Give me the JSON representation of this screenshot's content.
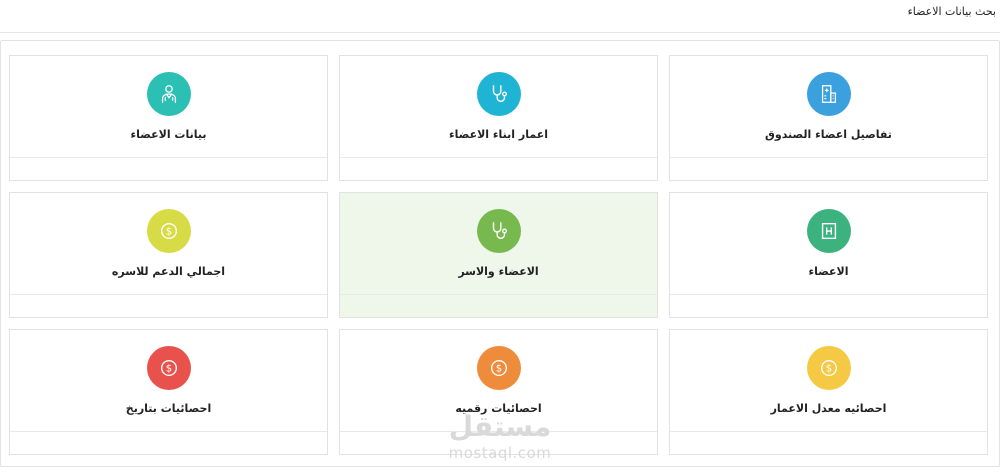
{
  "header": {
    "title": "بحث بيانات الاعضاء"
  },
  "cards": [
    {
      "label": "تفاصيل اعضاء الصندوق",
      "color": "#3ba0de",
      "icon": "hospital-icon"
    },
    {
      "label": "اعمار ابناء الاعضاء",
      "color": "#1fb4d3",
      "icon": "stethoscope-icon"
    },
    {
      "label": "بيانات الاعضاء",
      "color": "#2bc0b3",
      "icon": "doctor-icon"
    },
    {
      "label": "الاعضاء",
      "color": "#3cb37e",
      "icon": "hospital-sign-icon"
    },
    {
      "label": "الاعضاء والاسر",
      "color": "#78b94f",
      "icon": "stethoscope-icon"
    },
    {
      "label": "اجمالي الدعم للاسره",
      "color": "#d7dc46",
      "icon": "dollar-coin-icon"
    },
    {
      "label": "احصائيه معدل الاعمار",
      "color": "#f6c945",
      "icon": "dollar-coin-icon"
    },
    {
      "label": "احصائيات رقميه",
      "color": "#ef8c3c",
      "icon": "dollar-coin-icon"
    },
    {
      "label": "احصائيات بتاريخ",
      "color": "#e9524c",
      "icon": "dollar-coin-icon"
    }
  ],
  "watermark": {
    "arabic": "مستقل",
    "latin": "mostaql.com"
  }
}
